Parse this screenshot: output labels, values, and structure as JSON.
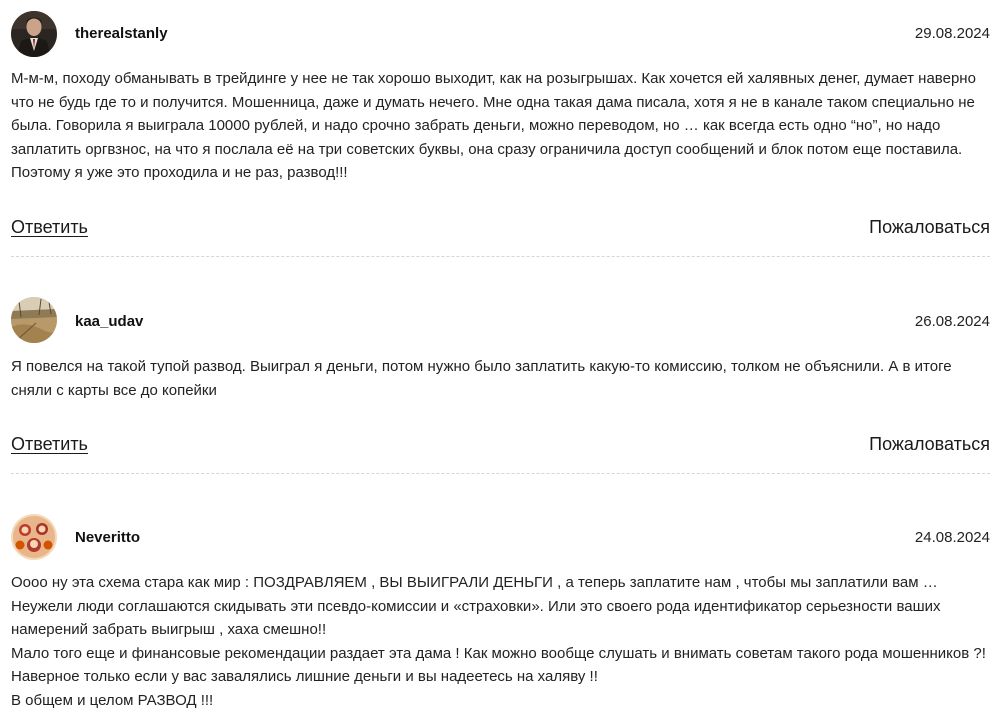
{
  "comments": [
    {
      "username": "therealstanly",
      "date": "29.08.2024",
      "avatar_icon": "user-avatar-photo-man-suit",
      "text": "М-м-м, походу обманывать в трейдинге у нее не так хорошо выходит, как на розыгрышах. Как хочется ей халявных денег, думает наверно что не будь где то и получится. Мошенница, даже и думать нечего. Мне одна такая дама писала, хотя я не в канале таком специально не была. Говорила я выиграла 10000 рублей, и надо срочно забрать деньги, можно переводом, но … как всегда есть одно “но”, но надо заплатить оргвзнос, на что я послала её на три советских буквы, она сразу ограничила доступ сообщений и блок потом еще поставила. Поэтому я уже это проходила и не раз, развод!!!",
      "reply_label": "Ответить",
      "report_label": "Пожаловаться"
    },
    {
      "username": "kaa_udav",
      "date": "26.08.2024",
      "avatar_icon": "user-avatar-photo-field",
      "text": "Я повелся на такой тупой развод. Выиграл я деньги, потом нужно было заплатить какую-то комиссию, толком не объяснили. А в итоге сняли с карты все до копейки",
      "reply_label": "Ответить",
      "report_label": "Пожаловаться"
    },
    {
      "username": "Neveritto",
      "date": "24.08.2024",
      "avatar_icon": "user-avatar-illustration-family",
      "paragraphs": [
        "Оооо ну эта схема стара как мир : ПОЗДРАВЛЯЕМ , ВЫ ВЫИГРАЛИ ДЕНЬГИ , а теперь заплатите нам , чтобы мы заплатили вам … Неужели люди соглашаются скидывать эти псевдо-комиссии и «страховки». Или это своего рода идентификатор серьезности ваших намерений забрать выигрыш , хаха смешно!!",
        "Мало того еще и финансовые рекомендации раздает эта дама ! Как можно вообще слушать и внимать советам такого рода мошенников ?! Наверное только если у вас завалялись лишние деньги и вы надеетесь на халяву !!",
        "В общем и целом РАЗВОД !!!"
      ]
    }
  ]
}
